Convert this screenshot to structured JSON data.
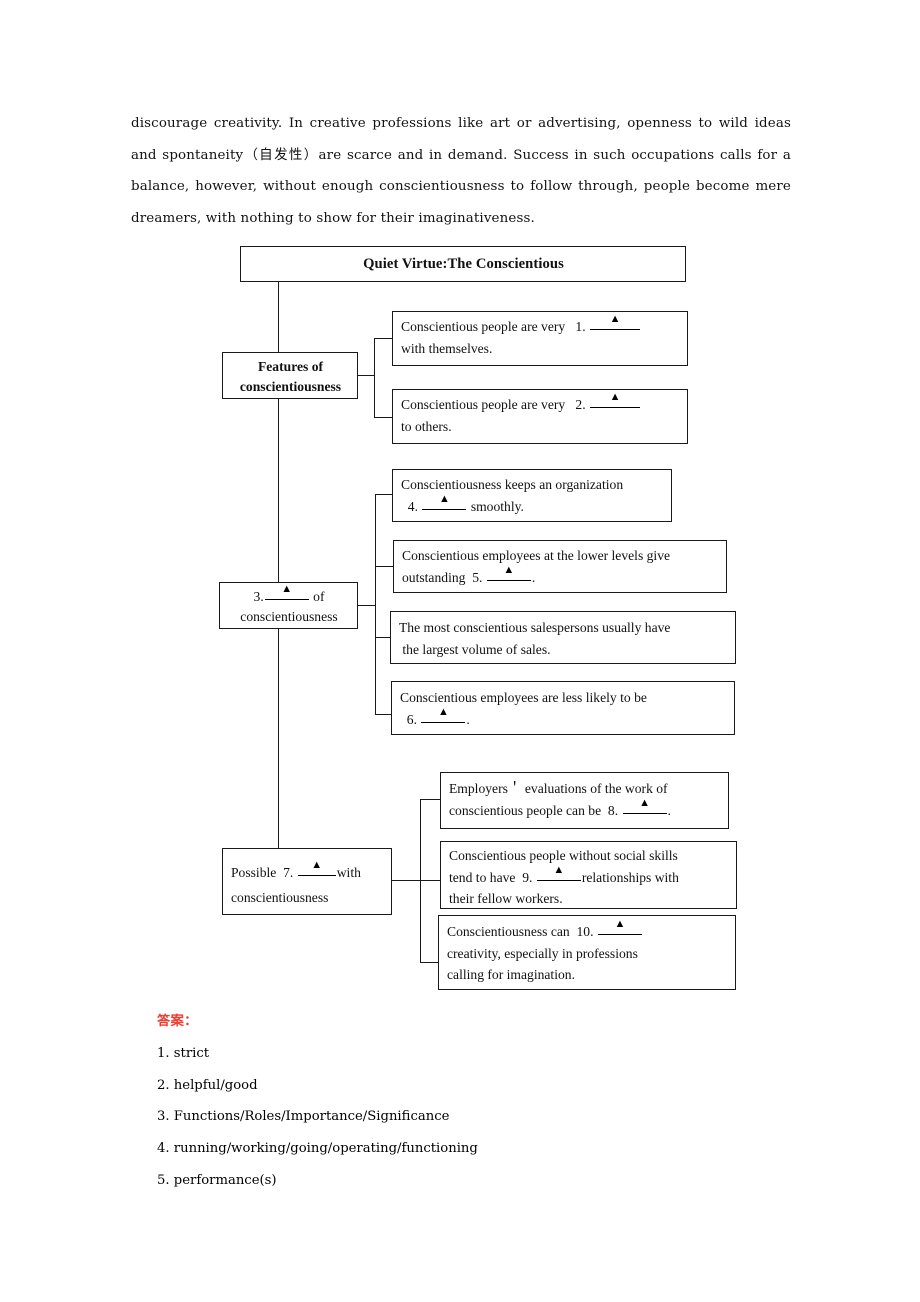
{
  "paragraph": {
    "text": "discourage creativity. In creative professions like art or advertising, openness to wild ideas and spontaneity（自发性）are scarce and in demand. Success in such occupations calls for a balance, however, without enough conscientiousness to follow through, people become mere dreamers, with nothing to show for their imaginativeness."
  },
  "chart": {
    "title": "Quiet Virtue:The Conscientious",
    "branch1": {
      "label_line1": "Features of",
      "label_line2": "conscientiousness",
      "items": [
        {
          "pre": "Conscientious people are very",
          "num": "1.",
          "post": "with themselves."
        },
        {
          "pre": "Conscientious people are very",
          "num": "2.",
          "post": "to others."
        }
      ]
    },
    "branch2": {
      "label_num": "3.",
      "label_of": "of",
      "label_line2": "conscientiousness",
      "items": [
        {
          "line1": "Conscientiousness keeps an organization",
          "num": "4.",
          "tail": "smoothly."
        },
        {
          "line1": "Conscientious employees at the lower levels give",
          "pre2": "outstanding",
          "num": "5.",
          "tail": "."
        },
        {
          "line1": "The most conscientious salespersons usually have",
          "line2": "the largest volume of sales."
        },
        {
          "line1": "Conscientious employees are less likely to be",
          "num": "6.",
          "tail": "."
        }
      ]
    },
    "branch3": {
      "label_pre": "Possible",
      "label_num": "7.",
      "label_post": "with",
      "label_line2": "conscientiousness",
      "items": [
        {
          "line1": "Employers＇ evaluations of the work of",
          "pre2": "conscientious people can be",
          "num": "8.",
          "tail": "."
        },
        {
          "line1": "Conscientious people without social skills",
          "pre2": "tend to have",
          "num": "9.",
          "tail": "relationships with",
          "line3": "their fellow workers."
        },
        {
          "pre1": "Conscientiousness can",
          "num": "10.",
          "line2": "creativity, especially in professions",
          "line3": "calling for imagination."
        }
      ]
    }
  },
  "answers": {
    "heading": "答案：",
    "items": [
      "1. strict",
      "2. helpful/good",
      "3. Functions/Roles/Importance/Significance",
      "4. running/working/going/operating/functioning",
      "5. performance(s)"
    ]
  },
  "colors": {
    "answer_heading": "#f23a2e",
    "box_border": "#1a1a1a",
    "text": "#111111"
  }
}
